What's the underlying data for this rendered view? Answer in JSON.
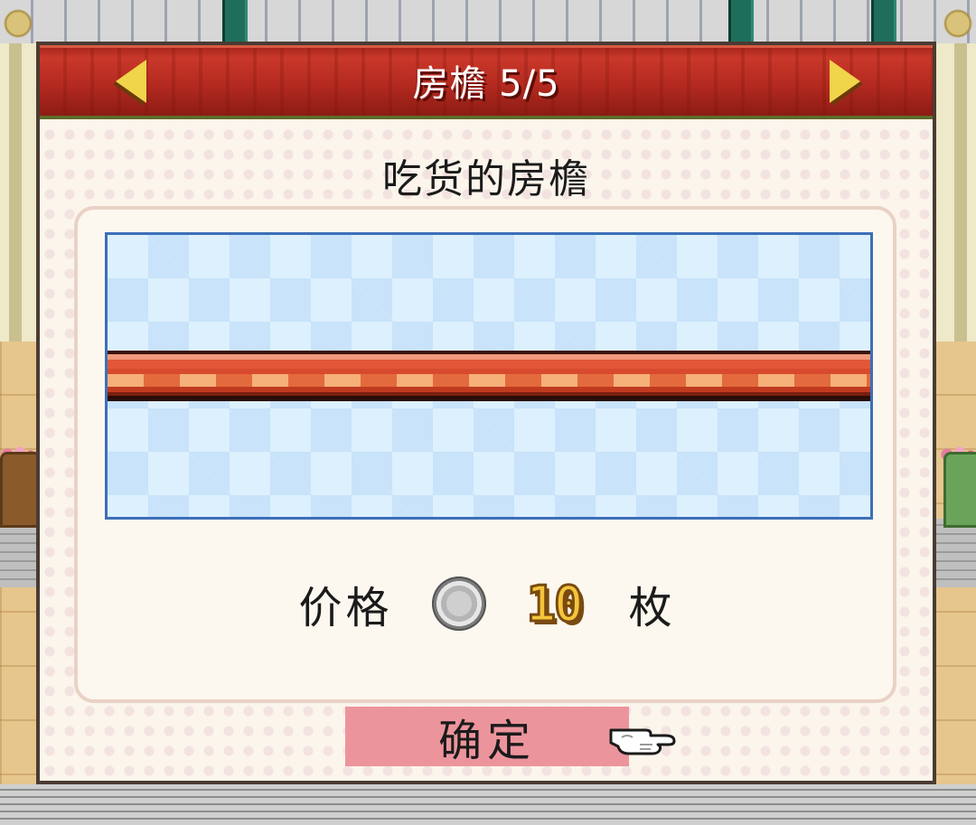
{
  "dialog": {
    "title": "房檐 5/5",
    "prev_icon": "arrow-left-icon",
    "next_icon": "arrow-right-icon",
    "item_name": "吃货的房檐",
    "price": {
      "label": "价格",
      "coin_icon": "silver-coin-icon",
      "value": "10",
      "unit": "枚"
    },
    "confirm_label": "确定",
    "pointer_icon": "pointing-hand-icon"
  },
  "colors": {
    "title_bar": "#b52a20",
    "confirm_button": "#ec949c",
    "preview_border": "#3d6fb8",
    "price_value": "#f4c53a"
  }
}
